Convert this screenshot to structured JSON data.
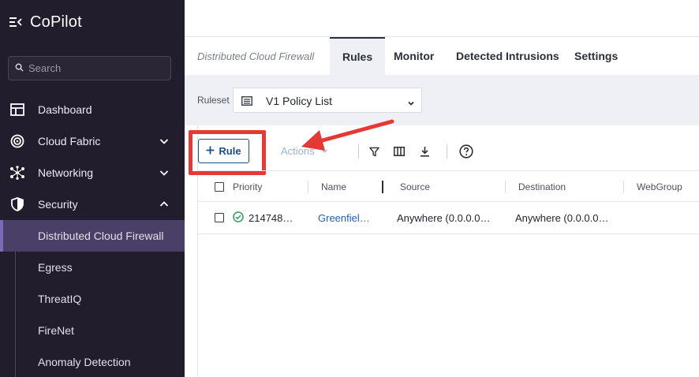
{
  "app": {
    "title": "CoPilot"
  },
  "sidebar": {
    "search_placeholder": "Search",
    "items": [
      {
        "label": "Dashboard"
      },
      {
        "label": "Cloud Fabric"
      },
      {
        "label": "Networking"
      },
      {
        "label": "Security"
      }
    ],
    "security_subitems": [
      {
        "label": "Distributed Cloud Firewall",
        "active": true
      },
      {
        "label": "Egress"
      },
      {
        "label": "ThreatIQ"
      },
      {
        "label": "FireNet"
      },
      {
        "label": "Anomaly Detection"
      }
    ]
  },
  "tabs": {
    "crumb": "Distributed Cloud Firewall",
    "items": [
      {
        "label": "Rules",
        "active": true
      },
      {
        "label": "Monitor"
      },
      {
        "label": "Detected Intrusions"
      },
      {
        "label": "Settings"
      }
    ]
  },
  "ruleset": {
    "label": "Ruleset",
    "value": "V1 Policy List"
  },
  "toolbar": {
    "rule_label": "Rule",
    "actions_label": "Actions"
  },
  "table": {
    "columns": [
      "Priority",
      "Name",
      "Source",
      "Destination",
      "WebGroup"
    ],
    "rows": [
      {
        "priority": "214748…",
        "name": "Greenfiel…",
        "source": "Anywhere (0.0.0.0…",
        "destination": "Anywhere (0.0.0.0…",
        "status": "enabled"
      }
    ]
  },
  "colors": {
    "sidebar_bg": "#211d2c",
    "active_item": "#4a3f66",
    "accent": "#1f4d8a",
    "link": "#2561a8",
    "highlight": "#e53935",
    "status_ok": "#2e9e57"
  }
}
